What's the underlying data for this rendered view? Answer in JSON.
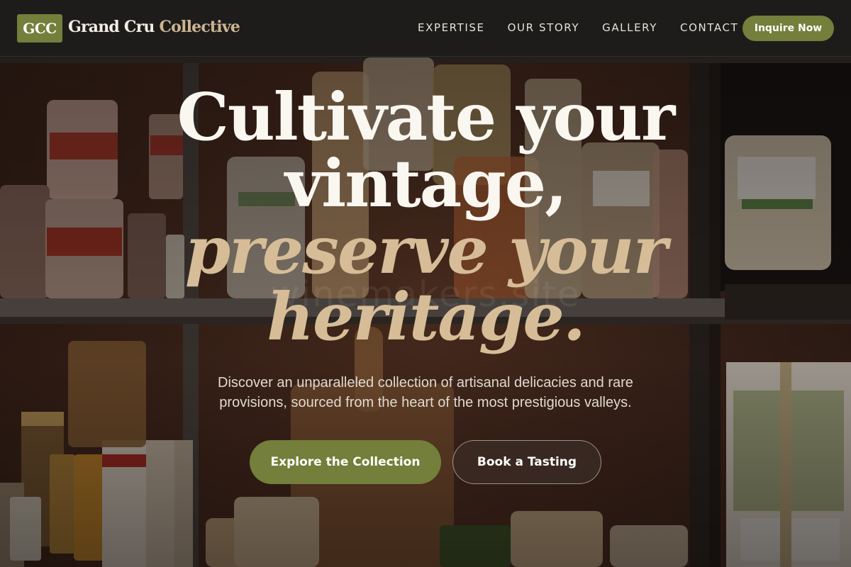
{
  "header": {
    "logo_badge": "GCC",
    "brand_primary": "Grand Cru",
    "brand_accent": "Collective",
    "nav": [
      "EXPERTISE",
      "OUR STORY",
      "GALLERY",
      "CONTACT"
    ],
    "cta_label": "Inquire Now"
  },
  "hero": {
    "headline_line1": "Cultivate your",
    "headline_line2": "vintage,",
    "headline_line3": "preserve your",
    "headline_line4": "heritage.",
    "watermark": "winemakers.site",
    "subtitle": "Discover an unparalleled collection of artisanal delicacies and rare provisions, sourced from the heart of the most prestigious valleys.",
    "primary_button": "Explore the Collection",
    "secondary_button": "Book a Tasting"
  },
  "colors": {
    "accent_green": "#737f3a",
    "gold": "#d6bd97",
    "header_bg": "#1d1c1b"
  }
}
